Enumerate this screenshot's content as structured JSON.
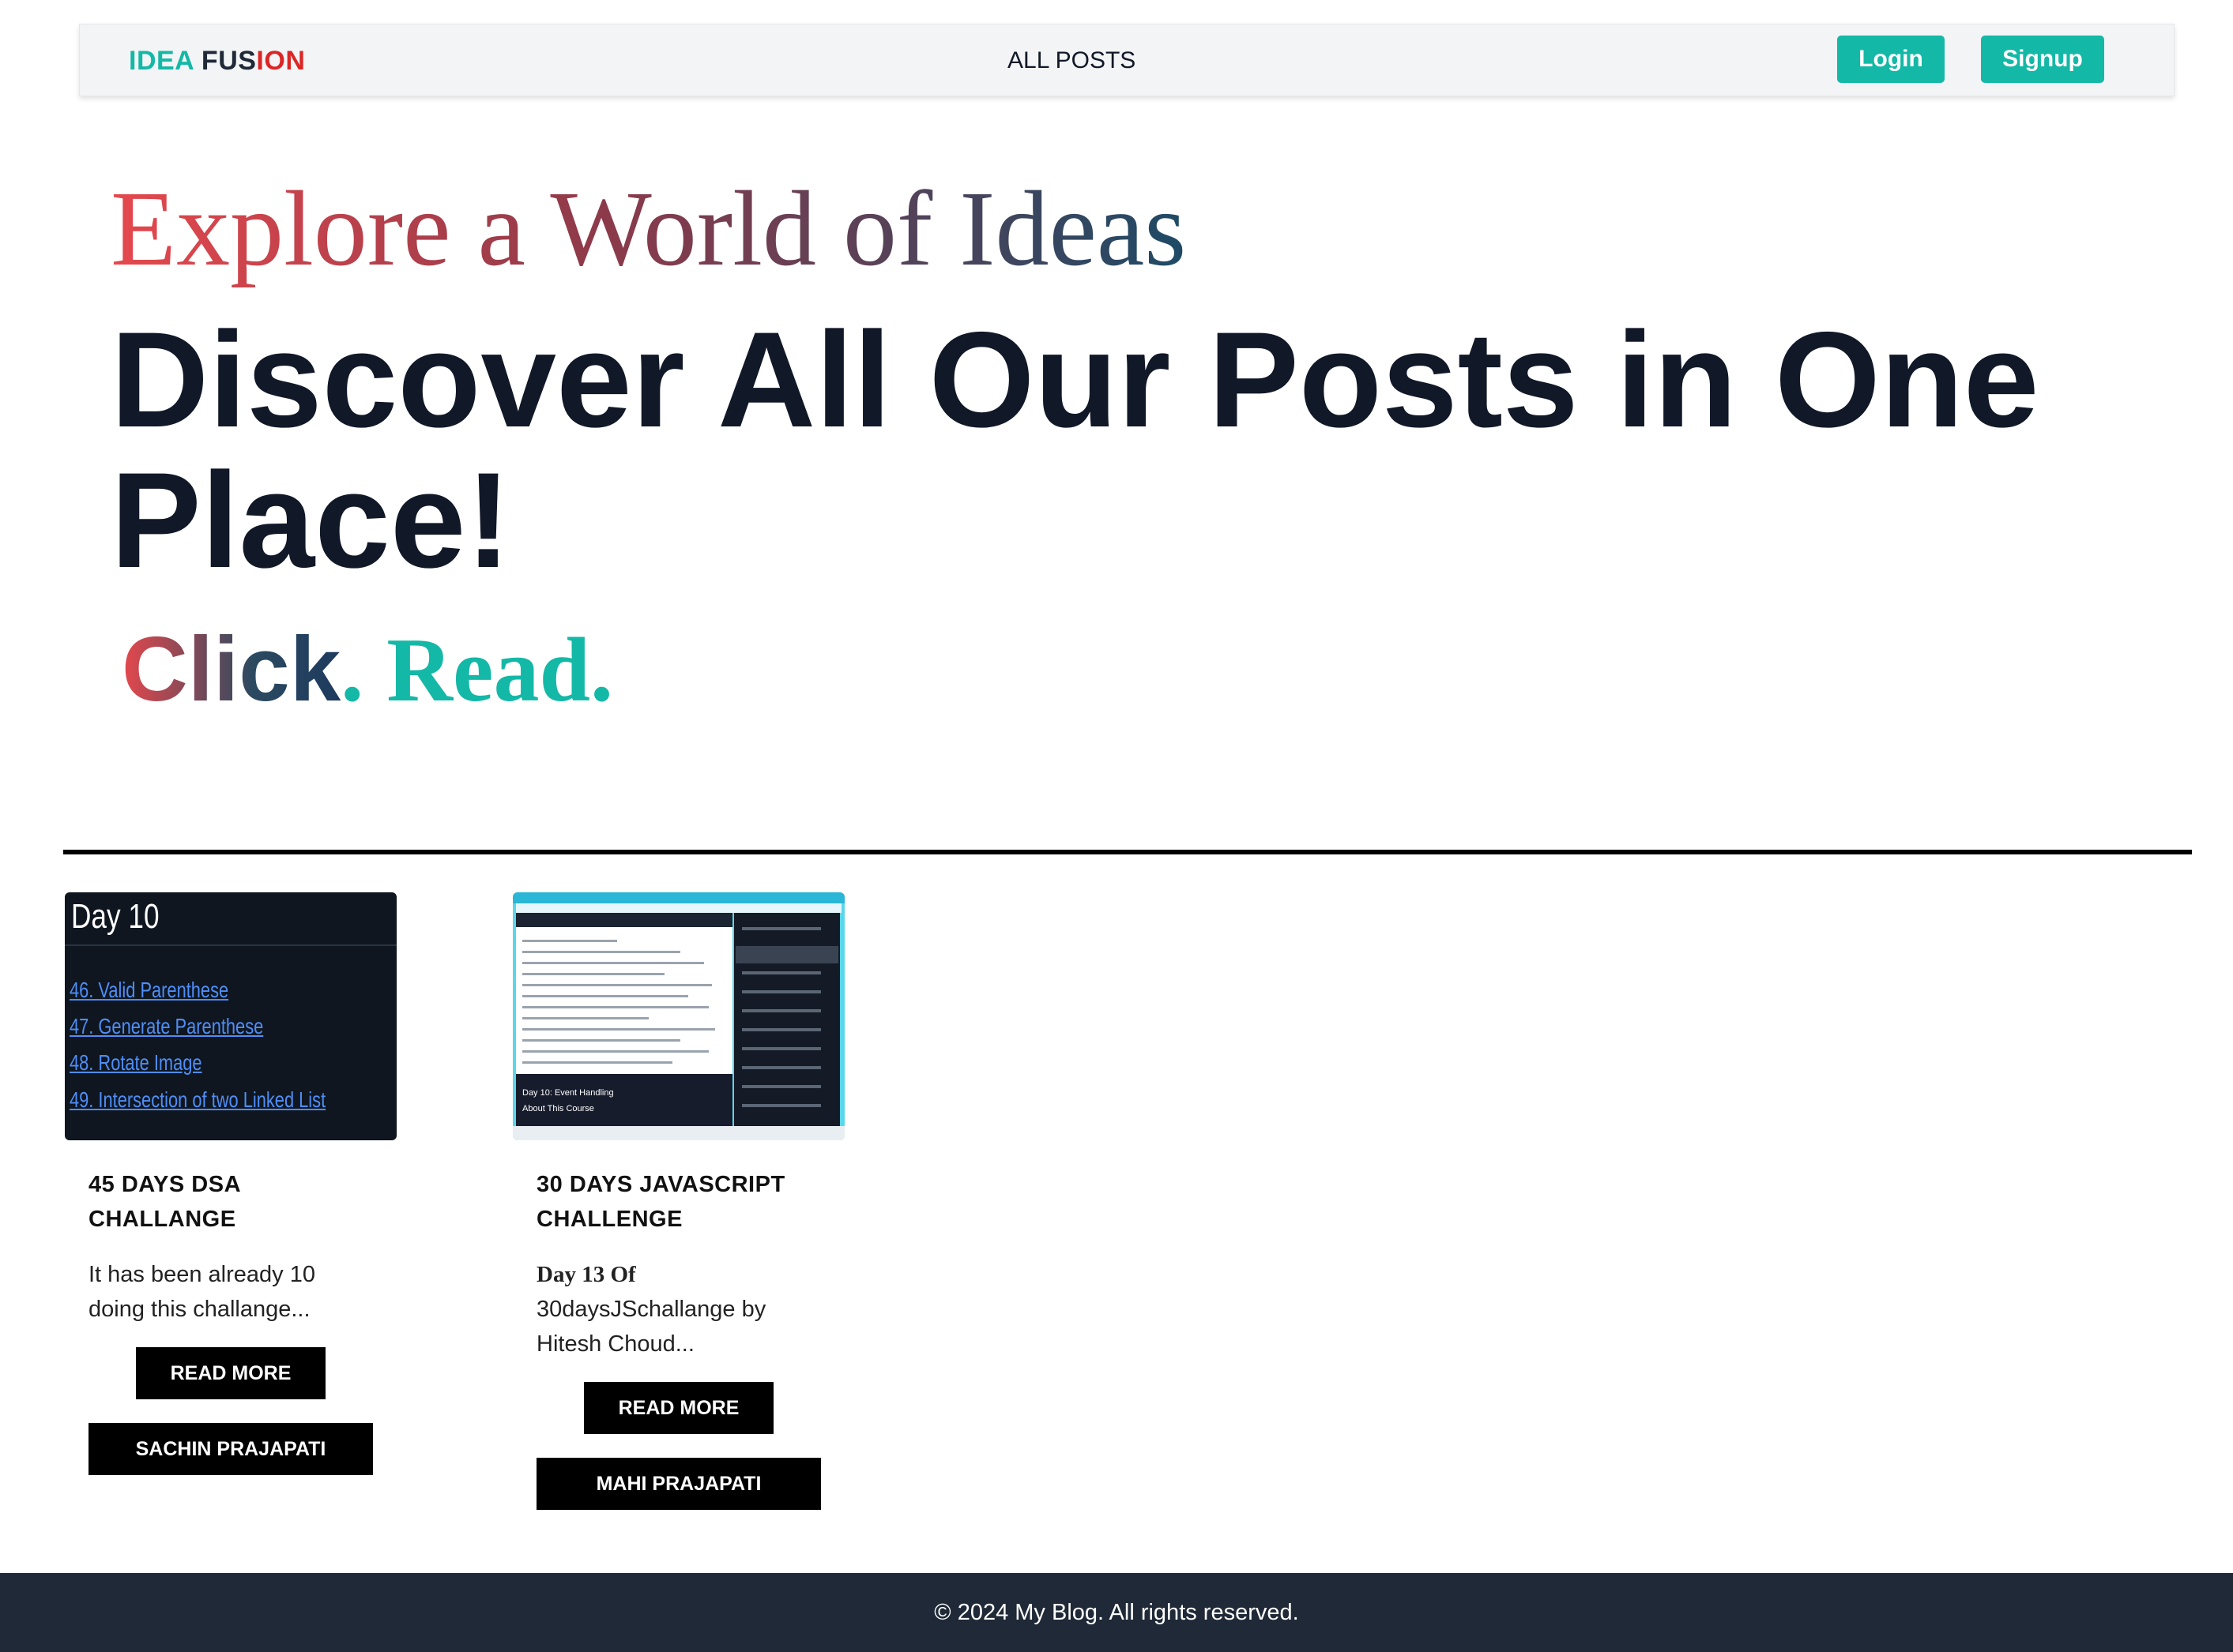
{
  "nav": {
    "brand_part1": "IDEA ",
    "brand_part2": "FUS",
    "brand_part3": "ION",
    "center_link": "ALL POSTS",
    "login_label": "Login",
    "signup_label": "Signup"
  },
  "hero": {
    "eyebrow": "Explore a World of Ideas",
    "title": "Discover All Our Posts in One Place!",
    "tag_click": "Click",
    "tag_dot1": ".",
    "tag_read": " Read",
    "tag_dot2": "."
  },
  "posts": [
    {
      "thumb_title": "Day 10",
      "thumb_links": [
        "46. Valid Parenthese",
        "47. Generate Parenthese",
        "48. Rotate Image",
        "49. Intersection of two Linked List"
      ],
      "title": "45 DAYS DSA CHALLANGE",
      "excerpt": "It has been already 10 doing this challange...",
      "read_more": "READ MORE",
      "author": "SACHIN PRAJAPATI"
    },
    {
      "thumb_banner_title": "Day 10: Event Handling",
      "thumb_banner_sub": "About This Course",
      "title": "30 DAYS JAVASCRIPT CHALLENGE",
      "excerpt_strong": "Day 13 Of",
      "excerpt": " 30daysJSchallange by Hitesh Choud...",
      "read_more": "READ MORE",
      "author": "MAHI PRAJAPATI"
    }
  ],
  "footer": {
    "text": "© 2024 My Blog. All rights reserved."
  },
  "colors": {
    "accent": "#14b8a6",
    "footer_bg": "#1f2937",
    "brand_red": "#dc2626"
  }
}
